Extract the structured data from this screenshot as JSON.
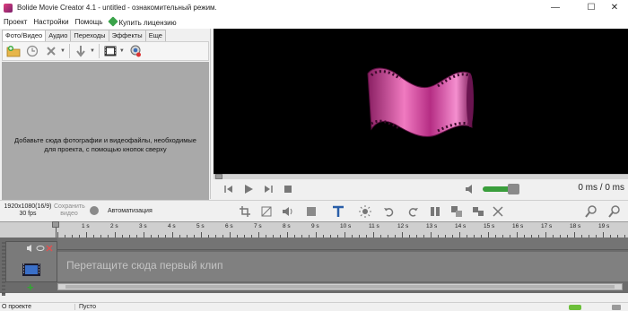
{
  "window": {
    "title": "Bolide Movie Creator 4.1 - untitled  - ознакомительный режим.",
    "controls": [
      "minimize-icon",
      "maximize-icon",
      "close-icon"
    ]
  },
  "menu": {
    "items": [
      "Проект",
      "Настройки",
      "Помощь"
    ],
    "license_label": "Купить лицензию"
  },
  "left_panel": {
    "tabs": [
      "Фото/Видео",
      "Аудио",
      "Переходы",
      "Эффекты",
      "Еще"
    ],
    "active_tab": "Фото/Видео",
    "toolbar_icons": [
      "add-folder-icon",
      "clock-icon",
      "delete-icon",
      "move-down-icon",
      "filmstrip-icon",
      "webcam-icon"
    ],
    "hint": "Добавьте сюда фотографии и видеофайлы, необходимые для проекта, с помощью кнопок сверху"
  },
  "player": {
    "timecode": "0 ms / 0 ms",
    "volume": 0.85,
    "buttons": [
      "prev-frame-icon",
      "play-icon",
      "next-frame-icon",
      "stop-icon",
      "volume-icon"
    ]
  },
  "timeline_toolbar": {
    "resolution": "1920x1080(16/9)",
    "fps": "30 fps",
    "save_video": "Сохранить видео",
    "automation": "Автоматизация",
    "tools": [
      "crop-icon",
      "resize-icon",
      "audio-icon",
      "layout-icon",
      "text-icon",
      "brightness-icon",
      "undo-icon",
      "redo-icon",
      "split-icon",
      "group-icon",
      "ungroup-icon",
      "cut-icon",
      "zoom-out-icon",
      "zoom-in-icon"
    ]
  },
  "timeline": {
    "ruler_labels": [
      "1 s",
      "2 s",
      "3 s",
      "4 s",
      "5 s",
      "6 s",
      "7 s",
      "8 s",
      "9 s",
      "10 s",
      "11 s",
      "12 s",
      "13 s",
      "14 s",
      "15 s",
      "16 s",
      "17 s",
      "18 s",
      "19 s"
    ],
    "drop_hint": "Перетащите сюда первый клип",
    "add_track": "+"
  },
  "status": {
    "project": "О проекте",
    "state": "Пусто"
  },
  "colors": {
    "preview_bg": "#000000",
    "media_area": "#a9a9a9",
    "track_bg": "#6b6b6b",
    "volume": "#3a9e3c",
    "film_logo": "#e04a9e"
  }
}
